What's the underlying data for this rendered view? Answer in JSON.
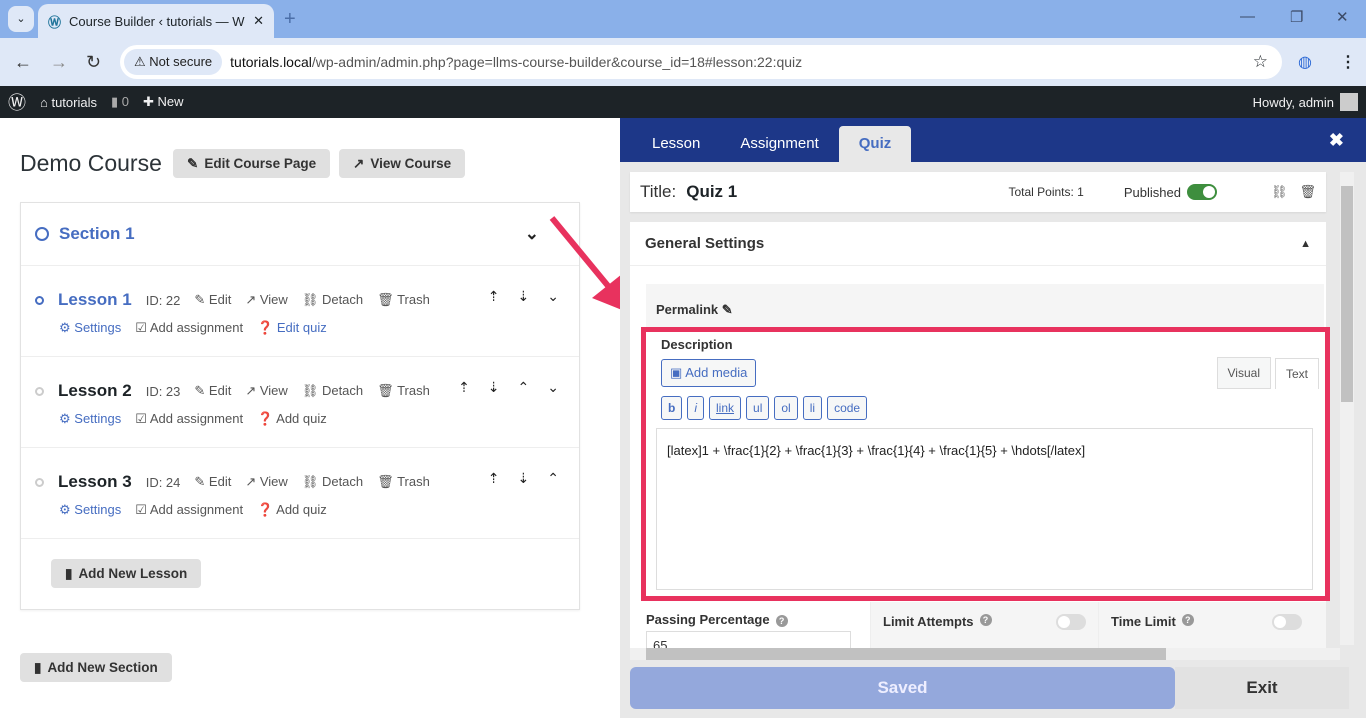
{
  "browser": {
    "tab_title": "Course Builder ‹ tutorials — Wo",
    "not_secure": "Not secure",
    "url_host": "tutorials.local",
    "url_path": "/wp-admin/admin.php?page=llms-course-builder&course_id=18#lesson:22:quiz"
  },
  "adminbar": {
    "site": "tutorials",
    "comments": "0",
    "new": "New",
    "howdy": "Howdy, admin"
  },
  "course": {
    "title": "Demo Course",
    "edit_page": "Edit Course Page",
    "view_course": "View Course",
    "section": "Section 1",
    "add_lesson": "Add New Lesson",
    "add_section": "Add New Section",
    "lessons": [
      {
        "title": "Lesson 1",
        "id": "ID: 22",
        "edit": "Edit",
        "view": "View",
        "detach": "Detach",
        "trash": "Trash",
        "settings": "Settings",
        "assignment": "Add assignment",
        "quiz": "Edit quiz"
      },
      {
        "title": "Lesson 2",
        "id": "ID: 23",
        "edit": "Edit",
        "view": "View",
        "detach": "Detach",
        "trash": "Trash",
        "settings": "Settings",
        "assignment": "Add assignment",
        "quiz": "Add quiz"
      },
      {
        "title": "Lesson 3",
        "id": "ID: 24",
        "edit": "Edit",
        "view": "View",
        "detach": "Detach",
        "trash": "Trash",
        "settings": "Settings",
        "assignment": "Add assignment",
        "quiz": "Add quiz"
      }
    ]
  },
  "panel": {
    "tabs": [
      "Lesson",
      "Assignment",
      "Quiz"
    ],
    "active_tab": "Quiz",
    "title_label": "Title:",
    "title": "Quiz 1",
    "total_points": "Total Points: 1",
    "published": "Published",
    "published_on": true,
    "general_settings": "General Settings",
    "permalink": "Permalink",
    "description": "Description",
    "add_media": "Add media",
    "visual": "Visual",
    "text": "Text",
    "toolbar": [
      "b",
      "i",
      "link",
      "ul",
      "ol",
      "li",
      "code"
    ],
    "content": "[latex]1 + \\frac{1}{2} + \\frac{1}{3} +  \\frac{1}{4} + \\frac{1}{5} + \\hdots[/latex]",
    "passing_percentage": "Passing Percentage",
    "passing_value": "65",
    "limit_attempts": "Limit Attempts",
    "time_limit": "Time Limit",
    "saved": "Saved",
    "exit": "Exit"
  },
  "colors": {
    "accent": "#466dc1",
    "panel_header": "#1d3788",
    "highlight": "#e8325e",
    "toggle_on": "#3e8e3e"
  }
}
